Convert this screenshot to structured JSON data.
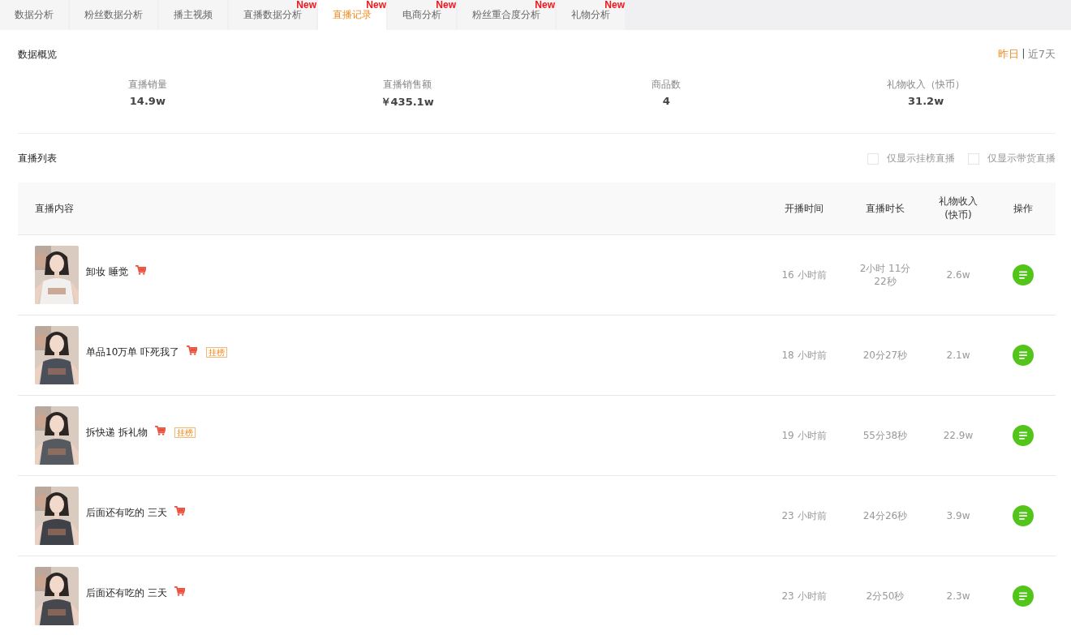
{
  "tabs": [
    {
      "label": "数据分析",
      "selected": false
    },
    {
      "label": "粉丝数据分析",
      "selected": false
    },
    {
      "label": "播主视频",
      "selected": false
    },
    {
      "label": "直播数据分析",
      "selected": false,
      "badge": "New"
    },
    {
      "label": "直播记录",
      "selected": true,
      "badge": "New"
    },
    {
      "label": "电商分析",
      "selected": false,
      "badge": "New"
    },
    {
      "label": "粉丝重合度分析",
      "selected": false,
      "badge": "New"
    },
    {
      "label": "礼物分析",
      "selected": false,
      "badge": "New"
    }
  ],
  "overview": {
    "title": "数据概览",
    "periods": [
      {
        "label": "昨日",
        "selected": true
      },
      {
        "label": "近7天",
        "selected": false
      }
    ],
    "period_separator": "|",
    "stats": [
      {
        "label": "直播销量",
        "value": "14.9w"
      },
      {
        "label": "直播销售额",
        "value": "￥435.1w"
      },
      {
        "label": "商品数",
        "value": "4"
      },
      {
        "label": "礼物收入（快币）",
        "value": "31.2w"
      }
    ]
  },
  "live_list": {
    "title": "直播列表",
    "filters": [
      {
        "label": "仅显示挂榜直播",
        "checked": false
      },
      {
        "label": "仅显示带货直播",
        "checked": false
      }
    ],
    "columns": [
      "直播内容",
      "开播时间",
      "直播时长",
      "礼物收入\n(快币)",
      "操作"
    ],
    "rows": [
      {
        "title": "卸妆 睡觉",
        "cart": true,
        "start": "16 小时前",
        "duration": "2小时 11分\n22秒",
        "gifts": "2.6w"
      },
      {
        "title": "单品10万单 吓死我了",
        "cart": true,
        "tag": "挂榜",
        "start": "18 小时前",
        "duration": "20分27秒",
        "gifts": "2.1w"
      },
      {
        "title": "拆快递 拆礼物",
        "cart": true,
        "tag": "挂榜",
        "start": "19 小时前",
        "duration": "55分38秒",
        "gifts": "22.9w"
      },
      {
        "title": "后面还有吃的 三天",
        "cart": true,
        "start": "23 小时前",
        "duration": "24分26秒",
        "gifts": "3.9w"
      },
      {
        "title": "后面还有吃的 三天",
        "cart": true,
        "start": "23 小时前",
        "duration": "2分50秒",
        "gifts": "2.3w"
      }
    ]
  }
}
